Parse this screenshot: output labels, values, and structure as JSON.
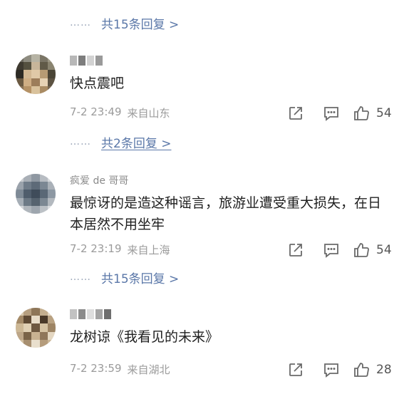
{
  "colors": {
    "link": "#5a77a8",
    "meta": "#9b9b9b",
    "text": "#1f1f1f"
  },
  "icons": {
    "repost": "share-square-icon",
    "comment": "comment-bubble-icon",
    "like": "thumbs-up-icon"
  },
  "top_reply": {
    "dots": "……",
    "text": "共15条回复 >"
  },
  "comments": [
    {
      "username": "",
      "body": "快点震吧",
      "date": "7-2 23:49",
      "location": "来自山东",
      "likes": "54",
      "replies": {
        "dots": "……",
        "text": "共2条回复 >"
      }
    },
    {
      "username": "疯爱 de 哥哥",
      "body": "最惊讶的是造这种谣言，旅游业遭受重大损失，在日本居然不用坐牢",
      "date": "7-2 23:19",
      "location": "来自上海",
      "likes": "54",
      "replies": {
        "dots": "……",
        "text": "共15条回复 >"
      }
    },
    {
      "username": "",
      "body": "龙树谅《我看见的未来》",
      "date": "7-2 23:59",
      "location": "来自湖北",
      "likes": "28"
    }
  ]
}
